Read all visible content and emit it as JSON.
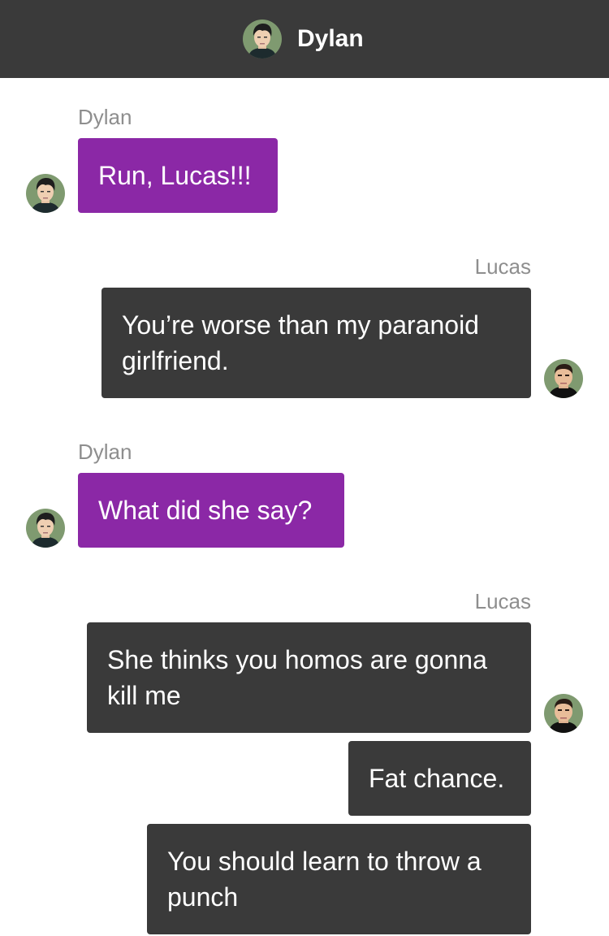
{
  "header": {
    "title": "Dylan",
    "avatar_icon": "dylan-avatar"
  },
  "colors": {
    "header_bg": "#3a3a3a",
    "dylan_bubble": "#8b28a6",
    "lucas_bubble": "#3a3a3a",
    "sender_text": "#8e8e8e",
    "avatar_bg": "#7f9a70"
  },
  "messages": [
    {
      "sender": "Dylan",
      "side": "left",
      "text": "Run, Lucas!!!"
    },
    {
      "sender": "Lucas",
      "side": "right",
      "text": "You’re worse than my paranoid girlfriend."
    },
    {
      "sender": "Dylan",
      "side": "left",
      "text": "What did she say?"
    },
    {
      "sender": "Lucas",
      "side": "right",
      "text": "She thinks you homos are gonna kill me"
    },
    {
      "sender": "",
      "side": "right",
      "text": "Fat chance."
    },
    {
      "sender": "",
      "side": "right",
      "text": "You should learn to throw a punch"
    }
  ]
}
